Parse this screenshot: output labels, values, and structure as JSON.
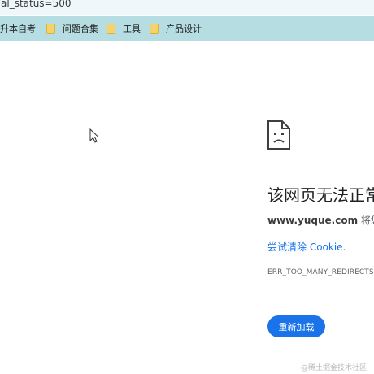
{
  "address_bar": {
    "url_fragment": "al_status=500"
  },
  "bookmarks": [
    {
      "label": "升本自考",
      "has_folder_icon": false
    },
    {
      "label": "问题合集",
      "has_folder_icon": true
    },
    {
      "label": "工具",
      "has_folder_icon": true
    },
    {
      "label": "产品设计",
      "has_folder_icon": true
    }
  ],
  "error_page": {
    "icon": "sad-page-icon",
    "title": "该网页无法正常",
    "domain": "www.yuque.com",
    "domain_suffix": " 将您重",
    "suggestion": "尝试清除 Cookie.",
    "error_code": "ERR_TOO_MANY_REDIRECTS",
    "reload_label": "重新加载"
  },
  "watermark": "@稀土掘金技术社区",
  "colors": {
    "accent": "#1a73e8",
    "bookmark_bar": "#b6dde2",
    "address_bar": "#eef7fa"
  }
}
